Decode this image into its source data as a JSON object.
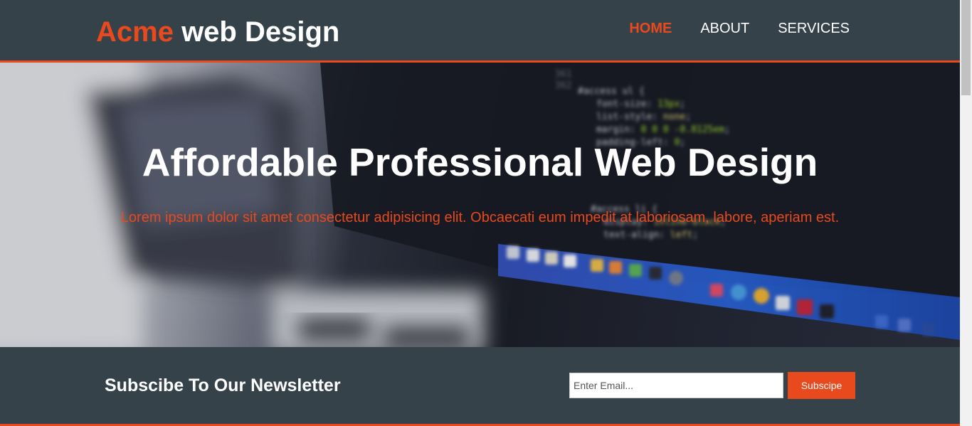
{
  "header": {
    "logo_highlight": "Acme",
    "logo_rest": " web Design",
    "nav": [
      {
        "label": "Home",
        "current": true
      },
      {
        "label": "About",
        "current": false
      },
      {
        "label": "Services",
        "current": false
      }
    ]
  },
  "showcase": {
    "title": "Affordable Professional Web Design",
    "text": "Lorem ipsum dolor sit amet consectetur adipisicing elit. Obcaecati eum impedit at laboriosam, labore, aperiam est."
  },
  "newsletter": {
    "title": "Subscibe To Our Newsletter",
    "email_placeholder": "Enter Email...",
    "button_label": "Subscipe"
  },
  "colors": {
    "accent": "#e8491d",
    "header_bg": "#35424a",
    "text_light": "#ffffff"
  }
}
